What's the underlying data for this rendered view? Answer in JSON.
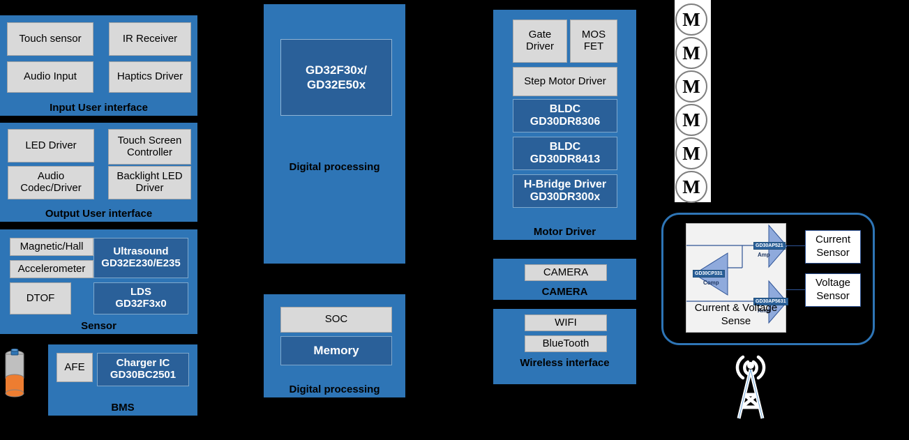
{
  "colors": {
    "panel_blue": "#2E75B6",
    "chip_blue": "#2A6099",
    "chip_gray": "#D9D9D9",
    "background": "#000000",
    "accent_navy": "#2F5496",
    "battery_orange": "#ED7D31"
  },
  "panels": {
    "input_ui": {
      "title": "Input User interface",
      "items": [
        "Touch sensor",
        "IR Receiver",
        "Audio Input",
        "Haptics Driver"
      ]
    },
    "output_ui": {
      "title": "Output User interface",
      "items": [
        "LED Driver",
        "Touch Screen Controller",
        "Audio Codec/Driver",
        "Backlight LED Driver"
      ]
    },
    "sensor": {
      "title": "Sensor",
      "gray_items": [
        "Magnetic/Hall",
        "Accelerometer",
        "DTOF"
      ],
      "blue_items": [
        {
          "line1": "Ultrasound",
          "line2": "GD32E230/E235"
        },
        {
          "line1": "LDS",
          "line2": "GD32F3x0"
        }
      ]
    },
    "bms": {
      "title": "BMS",
      "gray_items": [
        "AFE"
      ],
      "blue_items": [
        {
          "line1": "Charger IC",
          "line2": "GD30BC2501"
        }
      ],
      "battery_icon": "battery-cell-icon"
    },
    "digital_main": {
      "title": "Digital processing",
      "chip": {
        "line1": "GD32F30x/",
        "line2": "GD32E50x"
      }
    },
    "digital_soc": {
      "title": "Digital processing",
      "gray_items": [
        "SOC"
      ],
      "blue_items": [
        "Memory"
      ]
    },
    "motor_driver": {
      "title": "Motor Driver",
      "gray_items": [
        "Gate Driver",
        "MOS FET",
        "Step Motor Driver"
      ],
      "blue_items": [
        {
          "line1": "BLDC",
          "line2": "GD30DR8306"
        },
        {
          "line1": "BLDC",
          "line2": "GD30DR8413"
        },
        {
          "line1": "H-Bridge Driver",
          "line2": "GD30DR300x"
        }
      ]
    },
    "camera": {
      "title": "CAMERA",
      "gray_items": [
        "CAMERA"
      ]
    },
    "wireless": {
      "title": "Wireless interface",
      "gray_items": [
        "WIFI",
        "BlueTooth"
      ]
    }
  },
  "motors": {
    "label": "M",
    "count": 6
  },
  "sense": {
    "caption_line1": "Current & Voltage",
    "caption_line2": "Sense",
    "amps": [
      {
        "part": "GD30AP521",
        "type": "Amp"
      },
      {
        "part": "GD30AP5631",
        "type": "Amp"
      }
    ],
    "comparator": {
      "part": "GD30CP331",
      "type": "Comp"
    },
    "sensors": [
      {
        "line1": "Current",
        "line2": "Sensor"
      },
      {
        "line1": "Voltage",
        "line2": "Sensor"
      }
    ]
  },
  "antenna": {
    "icon": "antenna-tower-icon"
  }
}
